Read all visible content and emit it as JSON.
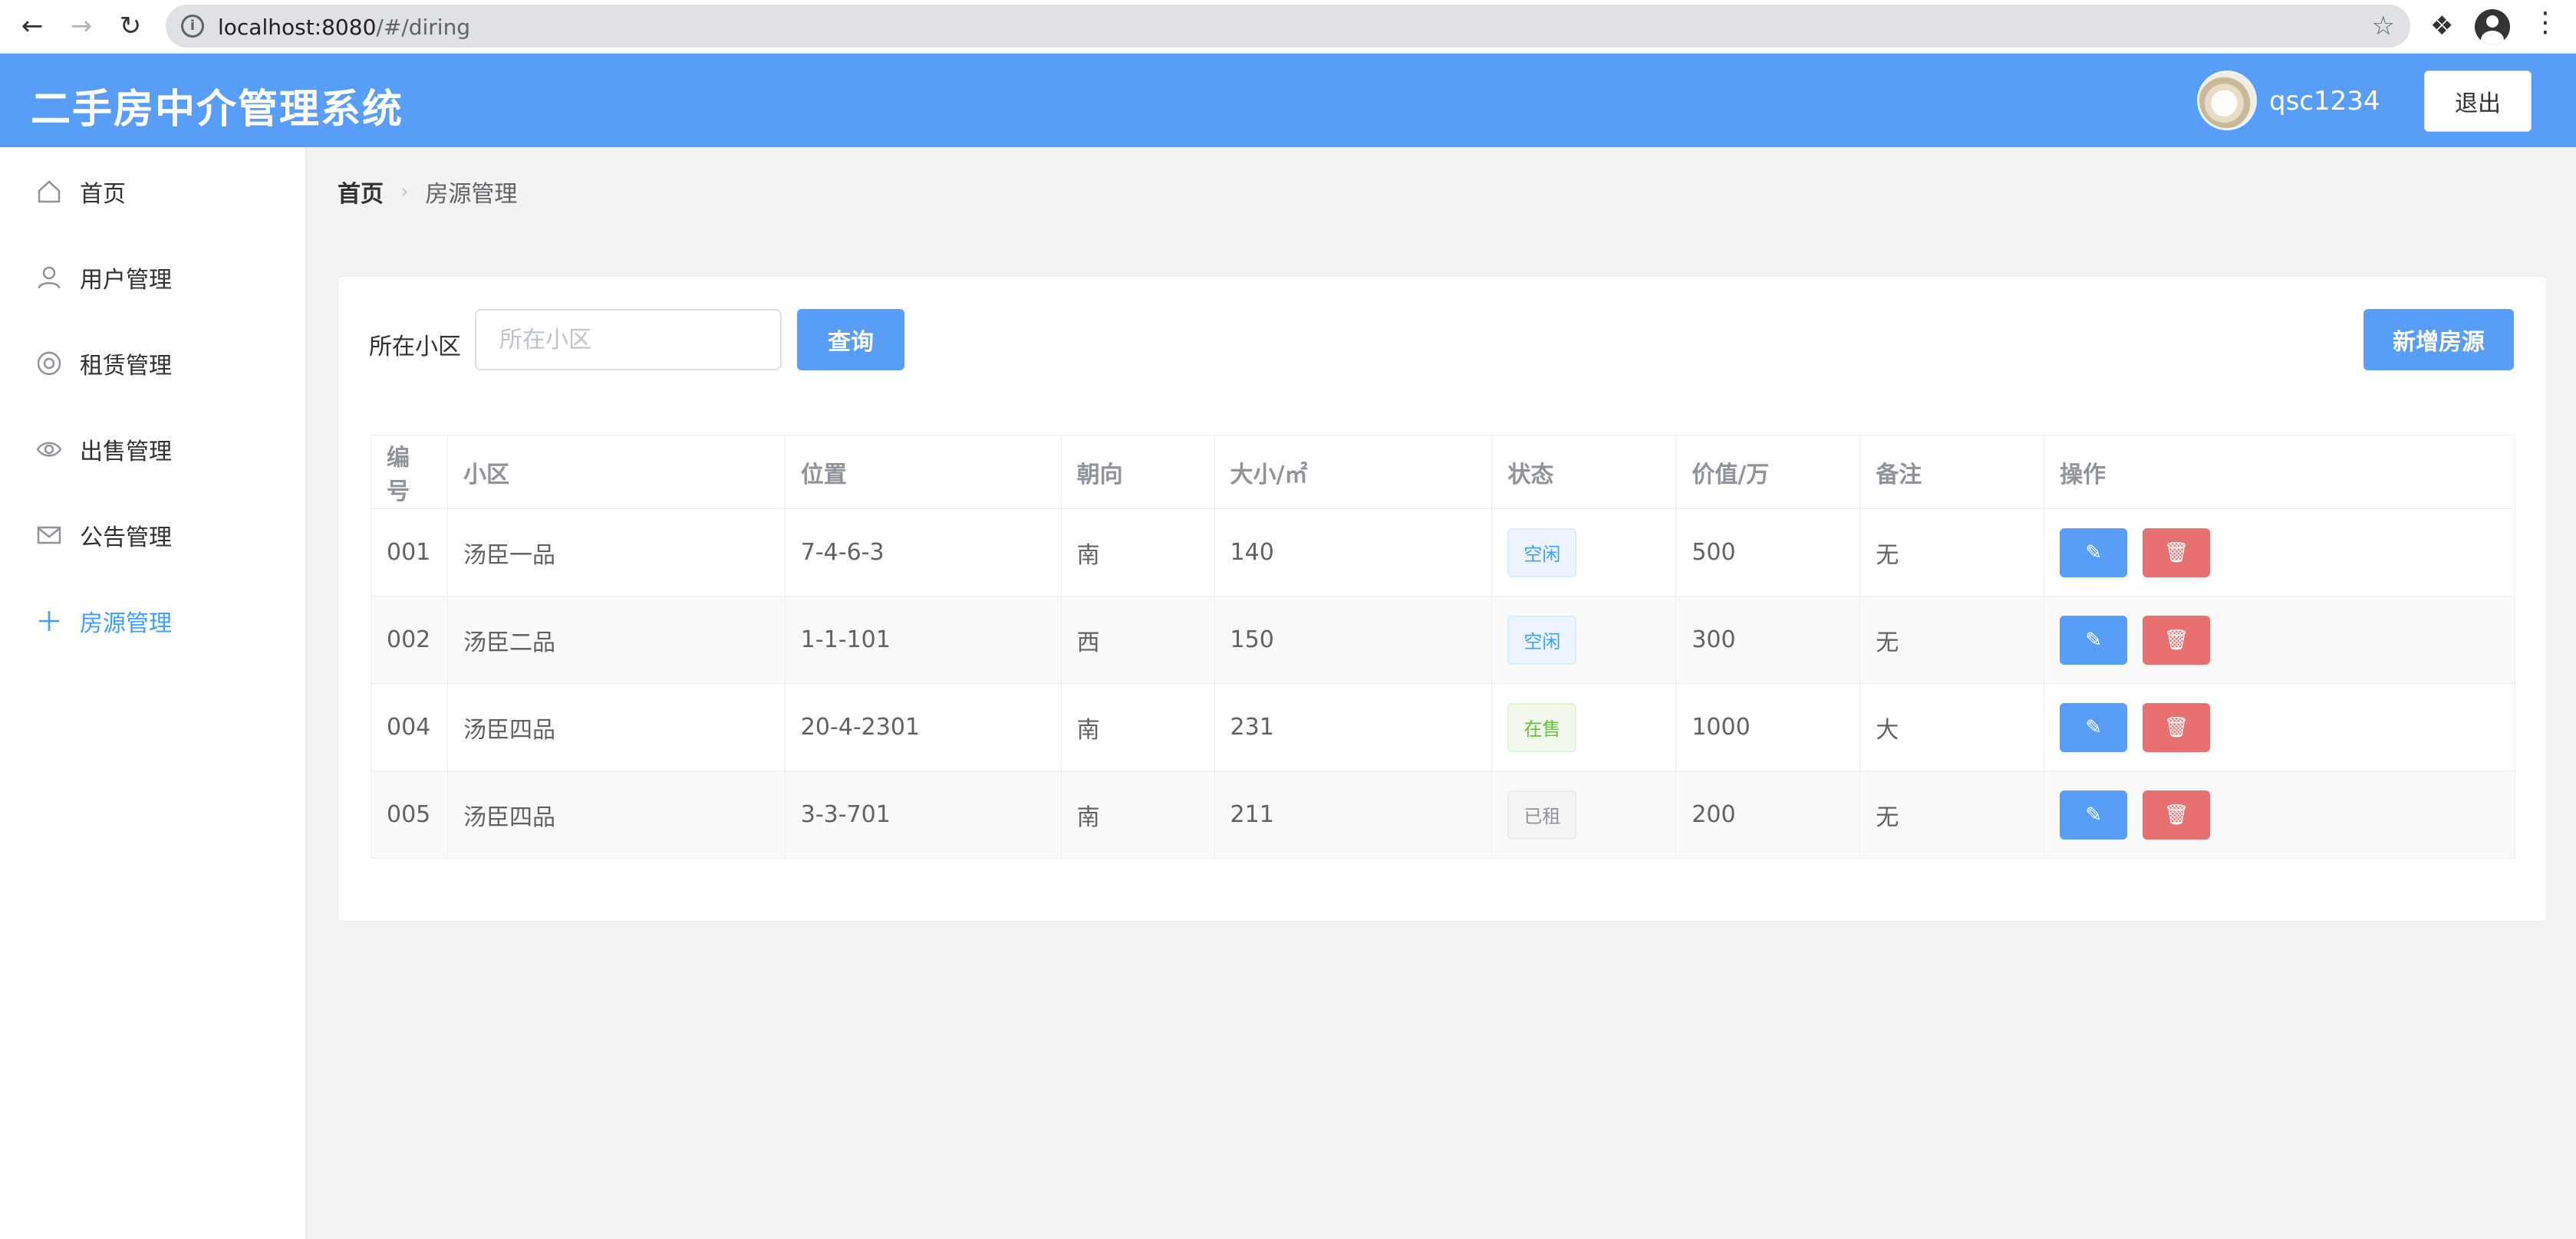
{
  "browser": {
    "url_host": "localhost:8080",
    "url_path": "/#/diring",
    "back_icon": "arrow-left-icon",
    "forward_icon": "arrow-right-icon",
    "reload_icon": "reload-icon"
  },
  "header": {
    "title": "二手房中介管理系统",
    "username": "qsc1234",
    "logout_label": "退出"
  },
  "sidebar": {
    "items": [
      {
        "label": "首页",
        "icon": "home-icon"
      },
      {
        "label": "用户管理",
        "icon": "user-icon"
      },
      {
        "label": "租赁管理",
        "icon": "lifebuoy-icon"
      },
      {
        "label": "出售管理",
        "icon": "eye-icon"
      },
      {
        "label": "公告管理",
        "icon": "envelope-icon"
      },
      {
        "label": "房源管理",
        "icon": "plus-icon",
        "active": true
      }
    ]
  },
  "breadcrumb": {
    "home": "首页",
    "current": "房源管理"
  },
  "filter": {
    "label": "所在小区",
    "placeholder": "所在小区",
    "value": "",
    "query_label": "查询",
    "add_label": "新增房源"
  },
  "table": {
    "headers": [
      "编号",
      "小区",
      "位置",
      "朝向",
      "大小/㎡",
      "状态",
      "价值/万",
      "备注",
      "操作"
    ],
    "rows": [
      {
        "id": "001",
        "community": "汤臣一品",
        "location": "7-4-6-3",
        "orientation": "南",
        "size": "140",
        "status": "空闲",
        "value": "500",
        "note": "无"
      },
      {
        "id": "002",
        "community": "汤臣二品",
        "location": "1-1-101",
        "orientation": "西",
        "size": "150",
        "status": "空闲",
        "value": "300",
        "note": "无"
      },
      {
        "id": "004",
        "community": "汤臣四品",
        "location": "20-4-2301",
        "orientation": "南",
        "size": "231",
        "status": "在售",
        "value": "1000",
        "note": "大"
      },
      {
        "id": "005",
        "community": "汤臣四品",
        "location": "3-3-701",
        "orientation": "南",
        "size": "211",
        "status": "已租",
        "value": "200",
        "note": "无"
      }
    ]
  },
  "colors": {
    "header_bg": "#589ef8",
    "primary": "#409eff",
    "danger": "#e97070"
  }
}
